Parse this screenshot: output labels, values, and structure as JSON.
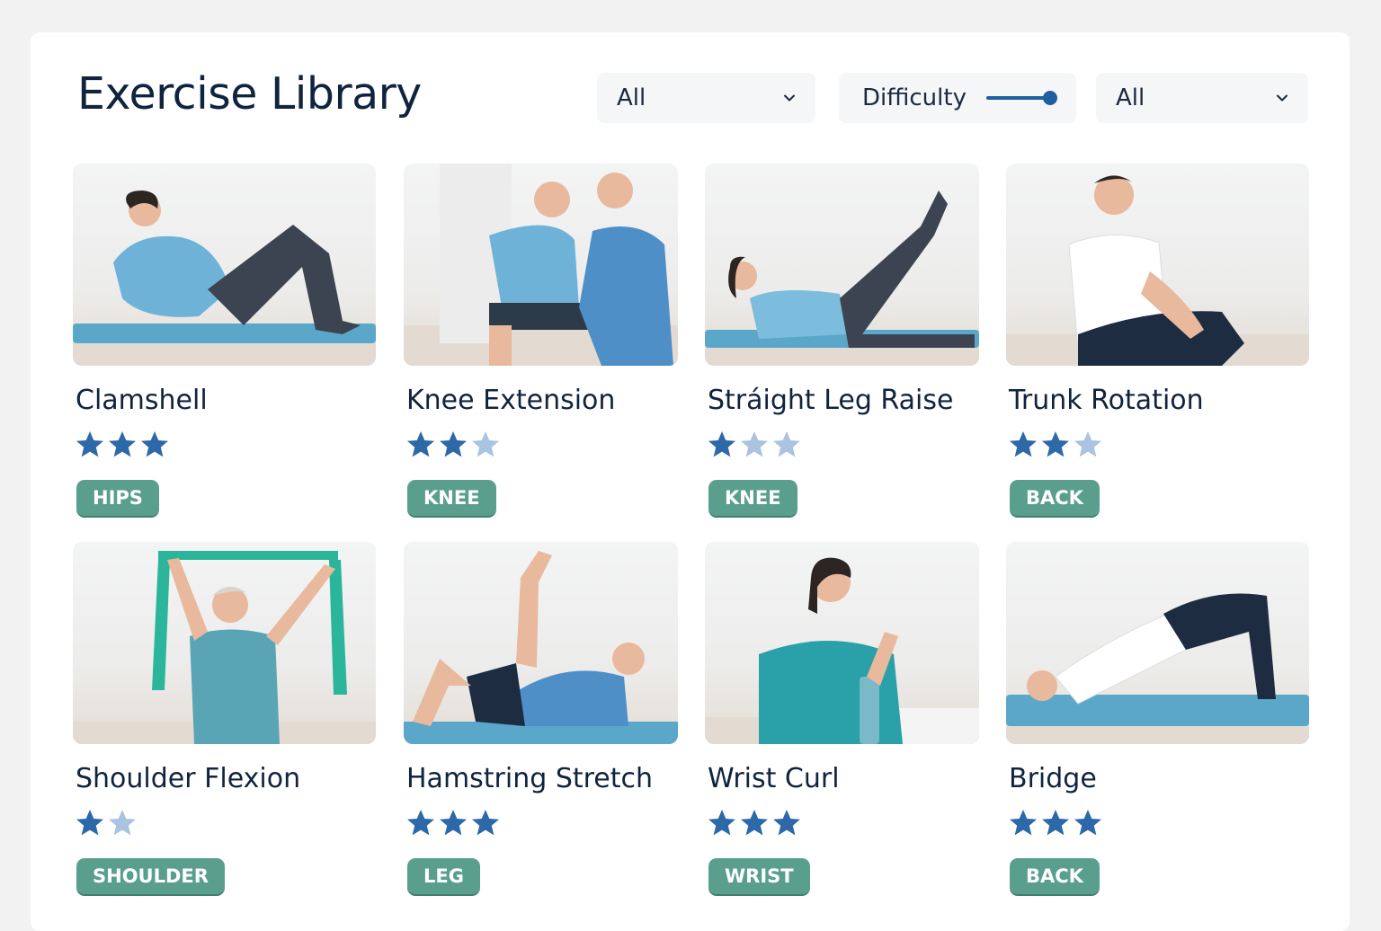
{
  "page": {
    "title": "Exercise Library"
  },
  "filters": {
    "body_area": {
      "value": "All",
      "icon": "chevron-down-icon"
    },
    "difficulty": {
      "label": "Difficulty",
      "level": 1.0
    },
    "category": {
      "value": "All",
      "icon": "chevron-down-icon"
    }
  },
  "colors": {
    "accent": "#1f5fa0",
    "star_filled": "#2d68a8",
    "star_empty": "#a9c3e0",
    "tag_bg": "#5a9f8e",
    "title": "#10233f"
  },
  "exercises": [
    {
      "name": "Clamshell",
      "difficulty": 3,
      "max": 3,
      "tag": "HIPS"
    },
    {
      "name": "Knee Extension",
      "difficulty": 2,
      "max": 3,
      "tag": "KNEE"
    },
    {
      "name": "Stráight Leg Raise",
      "difficulty": 1,
      "max": 3,
      "tag": "KNEE"
    },
    {
      "name": "Trunk Rotation",
      "difficulty": 2,
      "max": 3,
      "tag": "BACK"
    },
    {
      "name": "Shoulder Flexion",
      "difficulty": 1,
      "max": 2,
      "tag": "SHOULDER"
    },
    {
      "name": "Hamstring Stretch",
      "difficulty": 3,
      "max": 3,
      "tag": "LEG"
    },
    {
      "name": "Wrist Curl",
      "difficulty": 3,
      "max": 3,
      "tag": "WRIST"
    },
    {
      "name": "Bridge",
      "difficulty": 3,
      "max": 3,
      "tag": "BACK"
    }
  ]
}
